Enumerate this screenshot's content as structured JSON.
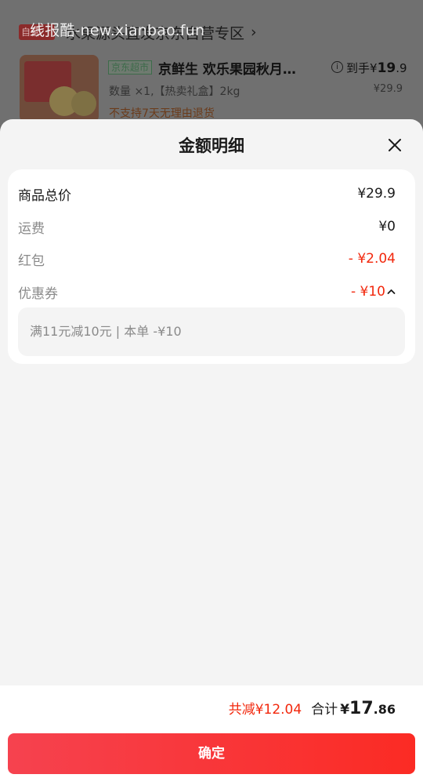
{
  "background": {
    "watermark": "线报酷-new.xianbao.fun",
    "store_badge": "自营",
    "store_name": "水果源头直发京东自营专区",
    "store_chevron": "›",
    "shop_tag": "京东超市",
    "product_title": "京鲜生 欢乐果园秋月…",
    "daoshou_label": "到手",
    "daoshou_currency": "¥",
    "daoshou_int": "19",
    "daoshou_dec": ".9",
    "original_price": "¥29.9",
    "quantity_text": "数量 ×1,【热卖礼盒】2kg",
    "no_return_text": "不支持7天无理由退货",
    "info_icon": "info-icon"
  },
  "sheet": {
    "title": "金额明细",
    "close_icon": "close-icon",
    "rows": [
      {
        "label": "商品总价",
        "value": "¥29.9"
      },
      {
        "label": "运费",
        "value": "¥0"
      },
      {
        "label": "红包",
        "value": "- ¥2.04"
      },
      {
        "label": "优惠券",
        "value": "- ¥10"
      }
    ],
    "coupon_detail": "满11元减10元 | 本单 -¥10",
    "caret_icon": "chevron-up-icon"
  },
  "footer": {
    "saved_text": "共减¥12.04",
    "total_label": "合计",
    "total_currency": "¥",
    "total_int": "17",
    "total_dec": ".86",
    "confirm_label": "确定"
  },
  "colors": {
    "accent_red": "#f2270c",
    "button_gradient_start": "#f6424f",
    "button_gradient_end": "#fb2b24"
  }
}
